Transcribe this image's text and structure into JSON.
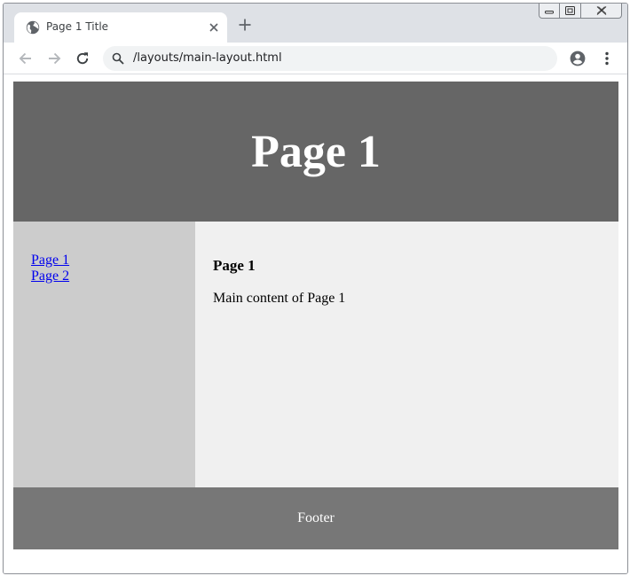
{
  "browser": {
    "tab": {
      "title": "Page 1 Title",
      "favicon": "globe-icon"
    },
    "address_bar": {
      "url": "/layouts/main-layout.html"
    },
    "icons": {
      "back": "arrow-left-icon",
      "forward": "arrow-right-icon",
      "reload": "reload-icon",
      "profile": "account-circle-icon",
      "menu": "kebab-menu-icon"
    }
  },
  "page": {
    "header": {
      "title": "Page 1"
    },
    "nav": {
      "links": [
        {
          "label": "Page 1"
        },
        {
          "label": "Page 2"
        }
      ]
    },
    "main": {
      "heading": "Page 1",
      "text": "Main content of Page 1"
    },
    "footer": {
      "text": "Footer"
    }
  },
  "colors": {
    "header_bg": "#666666",
    "sidebar_bg": "#cccccc",
    "content_bg": "#f0f0f0",
    "footer_bg": "#777777",
    "link": "#0000ee"
  }
}
